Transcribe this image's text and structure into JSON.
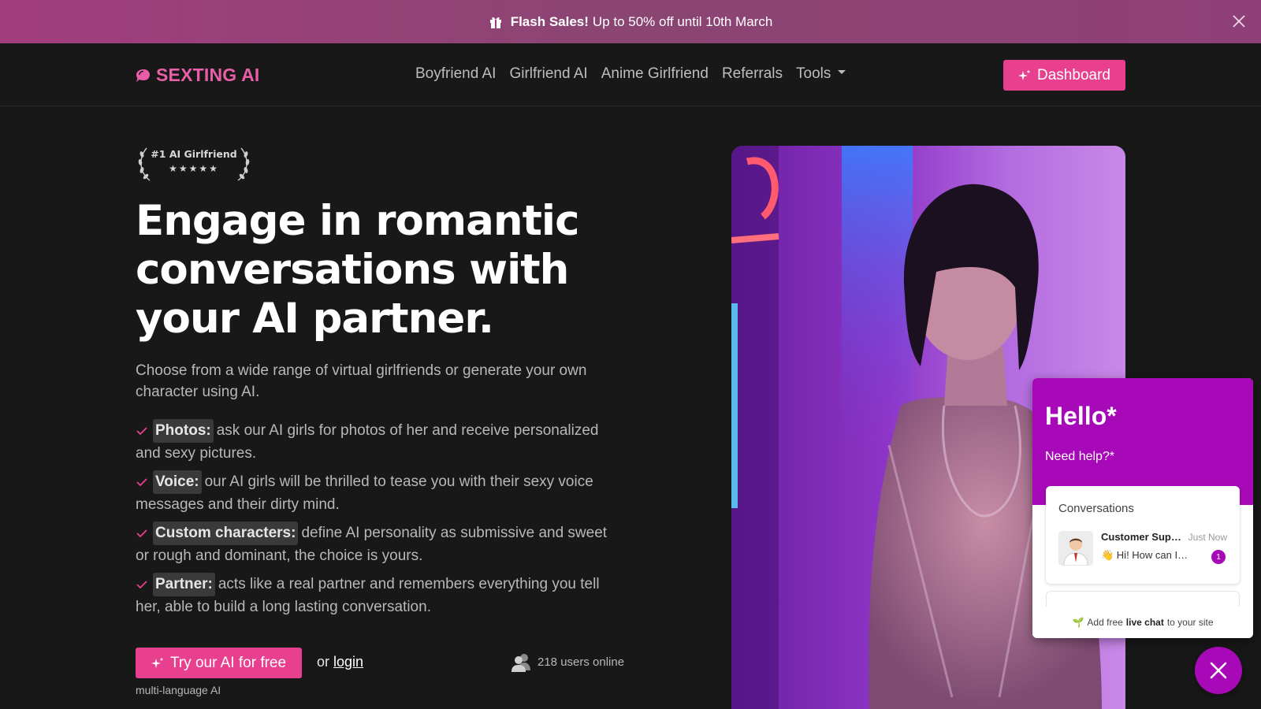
{
  "promo": {
    "title": "Flash Sales!",
    "text": "Up to 50% off until 10th March",
    "icon": "gift-icon",
    "close_icon": "close-icon"
  },
  "nav": {
    "brand": "SEXTING AI",
    "items": [
      {
        "label": "Boyfriend AI"
      },
      {
        "label": "Girlfriend AI"
      },
      {
        "label": "Anime Girlfriend"
      },
      {
        "label": "Referrals"
      },
      {
        "label": "Tools"
      }
    ],
    "dashboard_label": "Dashboard"
  },
  "hero": {
    "badge_text": "#1 AI Girlfriend",
    "badge_stars": "★★★★★",
    "headline": "Engage in romantic conversations with your AI partner.",
    "lead": "Choose from a wide range of virtual girlfriends or generate your own character using AI.",
    "features": [
      {
        "tag": "Photos:",
        "text": "ask our AI girls for photos of her and receive personalized and sexy pictures."
      },
      {
        "tag": "Voice:",
        "text": "our AI girls will be thrilled to tease you with their sexy voice messages and their dirty mind."
      },
      {
        "tag": "Custom characters:",
        "text": "define AI personality as submissive and sweet or rough and dominant, the choice is yours."
      },
      {
        "tag": "Partner:",
        "text": "acts like a real partner and remembers everything you tell her, able to build a long lasting conversation."
      }
    ],
    "cta_label": "Try our AI for free",
    "or_text": "or",
    "login_label": "login",
    "online_text": "218 users online",
    "multi_text": "multi-language AI"
  },
  "chat": {
    "hello": "Hello*",
    "need_help": "Need help?*",
    "conversations_title": "Conversations",
    "agent_name": "Customer Support",
    "time": "Just Now",
    "message": "👋 Hi! How can I help?",
    "unread": "1",
    "footer_prefix": "Add free",
    "footer_bold": "live chat",
    "footer_suffix": "to your site"
  },
  "colors": {
    "accent": "#e83f8f",
    "brand": "#e85fa8",
    "chat_purple": "#a709b8",
    "background": "#181818"
  }
}
